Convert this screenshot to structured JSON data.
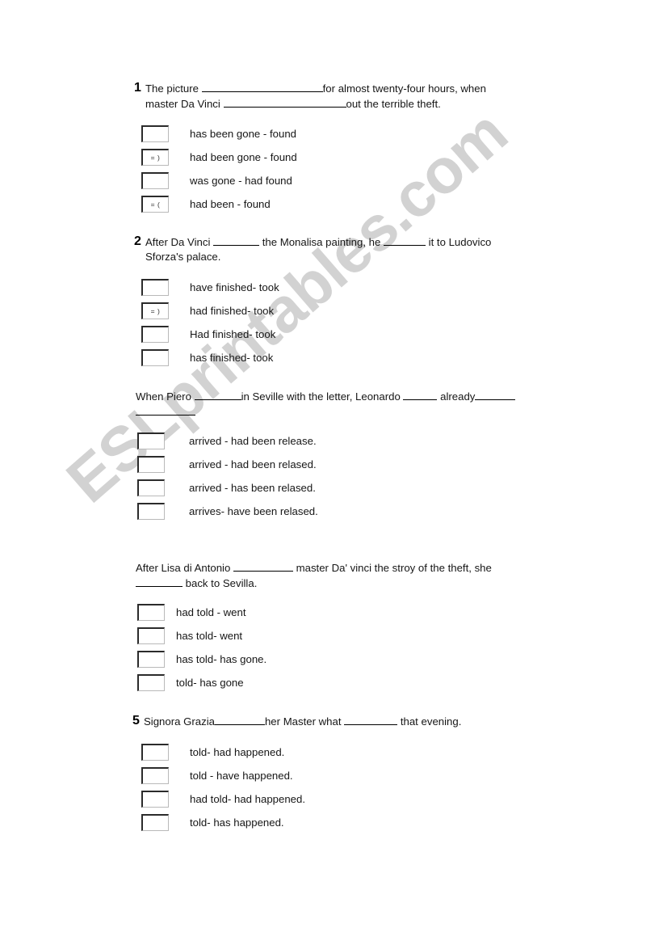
{
  "watermark": {
    "text": "ESLprintables.com",
    "color": "#d2d2d2"
  },
  "checkbox": {
    "marked_smile": "= )",
    "marked_frown": "= (",
    "empty": ""
  },
  "questions": [
    {
      "number": "1",
      "stem_line1_a": "The picture ",
      "stem_line1_b": "for almost twenty-four hours, when",
      "stem_line2_a": "master Da Vinci ",
      "stem_line2_b": "out the terrible theft.",
      "options": [
        {
          "mark": "",
          "label": "has been gone - found"
        },
        {
          "mark": "= )",
          "label": "had been gone - found"
        },
        {
          "mark": "",
          "label": "was gone - had found"
        },
        {
          "mark": "= (",
          "label": "had been - found"
        }
      ]
    },
    {
      "number": "2",
      "stem_line1_a": "After Da Vinci ",
      "stem_line1_b": " the Monalisa painting, he ",
      "stem_line1_c": " it to Ludovico",
      "stem_line2_a": "Sforza's palace.",
      "options": [
        {
          "mark": "",
          "label": "have finished- took"
        },
        {
          "mark": "= )",
          "label": "had finished- took"
        },
        {
          "mark": "",
          "label": "Had finished- took"
        },
        {
          "mark": "",
          "label": "has finished- took"
        }
      ]
    },
    {
      "number": "",
      "stem_line1_a": "When Piero ",
      "stem_line1_b": "in Seville with the letter, Leonardo ",
      "stem_line1_c": " already",
      "stem_line2_a": "",
      "options": [
        {
          "mark": "",
          "label": "arrived - had been release."
        },
        {
          "mark": "",
          "label": "arrived - had been relased."
        },
        {
          "mark": "",
          "label": "arrived - has been relased."
        },
        {
          "mark": "",
          "label": "arrives- have been relased."
        }
      ]
    },
    {
      "number": "",
      "stem_line1_a": "After Lisa di Antonio ",
      "stem_line1_b": " master Da' vinci the stroy of the theft, she",
      "stem_line2_a": " back to Sevilla.",
      "options": [
        {
          "mark": "",
          "label": "had told - went"
        },
        {
          "mark": "",
          "label": "has told- went"
        },
        {
          "mark": "",
          "label": "has told- has gone."
        },
        {
          "mark": "",
          "label": "told- has gone"
        }
      ]
    },
    {
      "number": "5",
      "stem_line1_a": "Signora Grazia",
      "stem_line1_b": "her Master what ",
      "stem_line1_c": " that evening.",
      "options": [
        {
          "mark": "",
          "label": "told- had happened."
        },
        {
          "mark": "",
          "label": "told - have happened."
        },
        {
          "mark": "",
          "label": "had told- had happened."
        },
        {
          "mark": "",
          "label": "told- has happened."
        }
      ]
    }
  ]
}
